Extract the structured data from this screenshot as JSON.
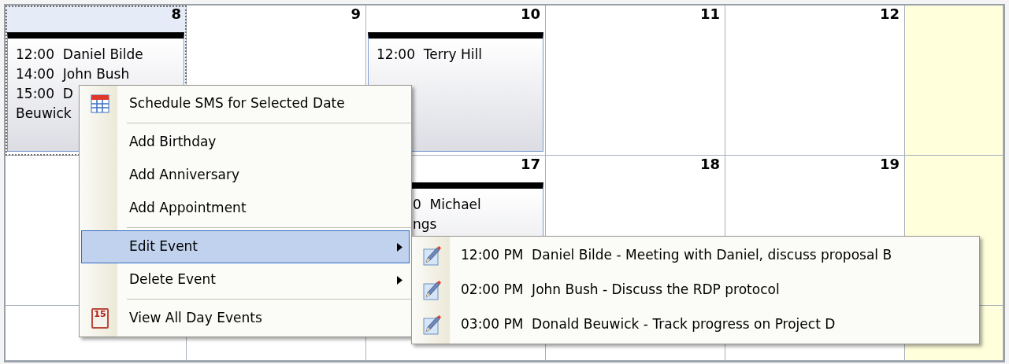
{
  "calendar": {
    "weeks": [
      {
        "days": [
          {
            "kind": "day",
            "number": "8",
            "selected": true,
            "weekend": false,
            "events": [
              "12:00  Daniel Bilde",
              "14:00  John Bush",
              "15:00  D",
              "Beuwick"
            ]
          },
          {
            "kind": "day",
            "number": "9",
            "selected": false,
            "weekend": false
          },
          {
            "kind": "day",
            "number": "10",
            "selected": false,
            "weekend": false,
            "events": [
              "12:00  Terry Hill"
            ]
          },
          {
            "kind": "day",
            "number": "11",
            "selected": false,
            "weekend": false
          },
          {
            "kind": "day",
            "number": "12",
            "selected": false,
            "weekend": false
          },
          {
            "kind": "day",
            "selected": false,
            "weekend": true
          }
        ]
      },
      {
        "days": [
          {
            "kind": "day",
            "selected": false,
            "weekend": false
          },
          {
            "kind": "covered"
          },
          {
            "kind": "day",
            "number": "17",
            "selected": false,
            "weekend": false,
            "events": [
              "0  Michael",
              "ngs"
            ]
          },
          {
            "kind": "day",
            "number": "18",
            "selected": false,
            "weekend": false
          },
          {
            "kind": "day",
            "number": "19",
            "selected": false,
            "weekend": false
          },
          {
            "kind": "day",
            "selected": false,
            "weekend": true
          }
        ]
      },
      {
        "days": [
          {
            "kind": "day",
            "selected": false,
            "weekend": false
          },
          {
            "kind": "day",
            "selected": false,
            "weekend": false
          },
          {
            "kind": "day",
            "selected": false,
            "weekend": false
          },
          {
            "kind": "day",
            "selected": false,
            "weekend": false
          },
          {
            "kind": "day",
            "selected": false,
            "weekend": false
          },
          {
            "kind": "day",
            "selected": false,
            "weekend": true
          }
        ]
      }
    ]
  },
  "context_menu": {
    "items": [
      {
        "kind": "item",
        "label": "Schedule SMS for Selected Date",
        "selected": false
      },
      {
        "kind": "separator"
      },
      {
        "kind": "item",
        "label": "Add Birthday",
        "selected": false
      },
      {
        "kind": "item",
        "label": "Add Anniversary",
        "selected": false
      },
      {
        "kind": "item",
        "label": "Add Appointment",
        "selected": false
      },
      {
        "kind": "separator"
      },
      {
        "kind": "item",
        "label": "Edit Event",
        "selected": true,
        "has_submenu": true
      },
      {
        "kind": "item",
        "label": "Delete Event",
        "selected": false,
        "has_submenu": true
      },
      {
        "kind": "separator"
      },
      {
        "kind": "item",
        "label": "View All Day Events",
        "icon_text": "15",
        "selected": false
      }
    ]
  },
  "submenu": {
    "items": [
      {
        "time": "12:00 PM",
        "label": "Daniel Bilde - Meeting with Daniel, discuss proposal B"
      },
      {
        "time": "02:00 PM",
        "label": "John Bush - Discuss the RDP protocol"
      },
      {
        "time": "03:00 PM",
        "label": "Donald Beuwick - Track progress on Project D"
      }
    ]
  }
}
